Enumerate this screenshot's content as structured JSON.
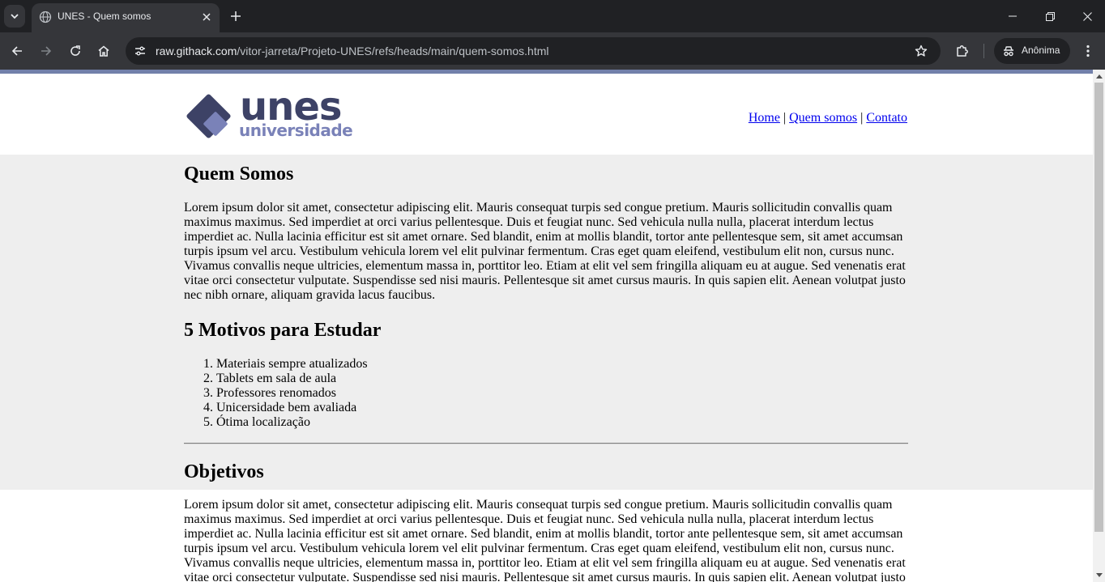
{
  "browser": {
    "tab_title": "UNES - Quem somos",
    "url_host": "raw.githack.com",
    "url_path": "/vitor-jarreta/Projeto-UNES/refs/heads/main/quem-somos.html",
    "profile_label": "Anônima",
    "icons": {
      "tab_list": "chevron-down-icon",
      "favicon": "globe-icon",
      "tab_close": "close-icon",
      "new_tab": "plus-icon",
      "back": "arrow-left-icon",
      "forward": "arrow-right-icon",
      "reload": "reload-icon",
      "home": "home-icon",
      "site_info": "tune-icon",
      "bookmark": "star-icon",
      "extensions": "puzzle-icon",
      "incognito": "incognito-icon",
      "menu": "kebab-icon"
    }
  },
  "header": {
    "logo": {
      "word": "unes",
      "sub": "universidade"
    },
    "nav": [
      {
        "label": "Home"
      },
      {
        "label": "Quem somos"
      },
      {
        "label": "Contato"
      }
    ],
    "separator": "|"
  },
  "sections": {
    "about": {
      "title": "Quem Somos",
      "text": "Lorem ipsum dolor sit amet, consectetur adipiscing elit. Mauris consequat turpis sed congue pretium. Mauris sollicitudin convallis quam maximus maximus. Sed imperdiet at orci varius pellentesque. Duis et feugiat nunc. Sed vehicula nulla nulla, placerat interdum lectus imperdiet ac. Nulla lacinia efficitur est sit amet ornare. Sed blandit, enim at mollis blandit, tortor ante pellentesque sem, sit amet accumsan turpis ipsum vel arcu. Vestibulum vehicula lorem vel elit pulvinar fermentum. Cras eget quam eleifend, vestibulum elit non, cursus nunc. Vivamus convallis neque ultricies, elementum massa in, porttitor leo. Etiam at elit vel sem fringilla aliquam eu at augue. Sed venenatis erat vitae orci consectetur vulputate. Suspendisse sed nisi mauris. Pellentesque sit amet cursus mauris. In quis sapien elit. Aenean volutpat justo nec nibh ornare, aliquam gravida lacus faucibus."
    },
    "reasons": {
      "title": "5 Motivos para Estudar",
      "items": [
        "Materiais sempre atualizados",
        "Tablets em sala de aula",
        "Professores renomados",
        "Unicersidade bem avaliada",
        "Ótima localização"
      ]
    },
    "objectives": {
      "title": "Objetivos",
      "text": "Lorem ipsum dolor sit amet, consectetur adipiscing elit. Mauris consequat turpis sed congue pretium. Mauris sollicitudin convallis quam maximus maximus. Sed imperdiet at orci varius pellentesque. Duis et feugiat nunc. Sed vehicula nulla nulla, placerat interdum lectus imperdiet ac. Nulla lacinia efficitur est sit amet ornare. Sed blandit, enim at mollis blandit, tortor ante pellentesque sem, sit amet accumsan turpis ipsum vel arcu. Vestibulum vehicula lorem vel elit pulvinar fermentum. Cras eget quam eleifend, vestibulum elit non, cursus nunc. Vivamus convallis neque ultricies, elementum massa in, porttitor leo. Etiam at elit vel sem fringilla aliquam eu at augue. Sed venenatis erat vitae orci consectetur vulputate. Suspendisse sed nisi mauris. Pellentesque sit amet cursus mauris. In quis sapien elit. Aenean volutpat justo nec nibh ornare, aliquam gravida lacus faucibus."
    }
  },
  "colors": {
    "accent_bar": "#7280aa",
    "logo_dark": "#3d4266",
    "logo_light": "#7a82b8",
    "section_bg": "#eeeeee",
    "link": "#0000ee"
  }
}
